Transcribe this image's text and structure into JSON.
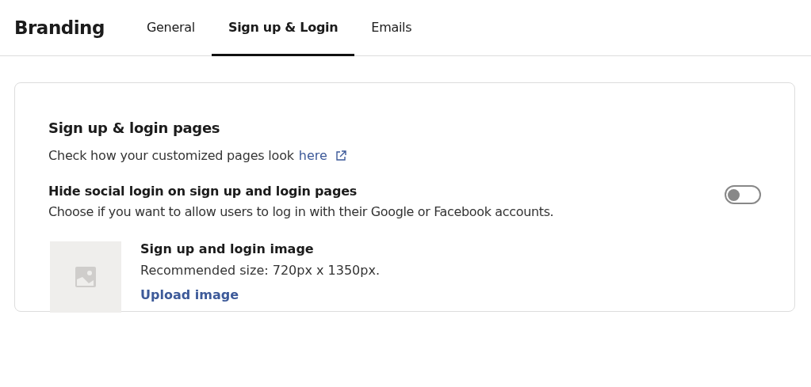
{
  "header": {
    "title": "Branding"
  },
  "tabs": [
    {
      "label": "General",
      "selected": false
    },
    {
      "label": "Sign up & Login",
      "selected": true
    },
    {
      "label": "Emails",
      "selected": false
    }
  ],
  "card": {
    "title": "Sign up & login pages",
    "preview_text": "Check how your customized pages look",
    "preview_link": "here",
    "setting": {
      "label": "Hide social login on sign up and login pages",
      "description": "Choose if you want to allow users to log in with their Google or Facebook accounts.",
      "on": false
    },
    "image": {
      "title": "Sign up and login image",
      "hint": "Recommended size: 720px x 1350px.",
      "action": "Upload image"
    }
  }
}
